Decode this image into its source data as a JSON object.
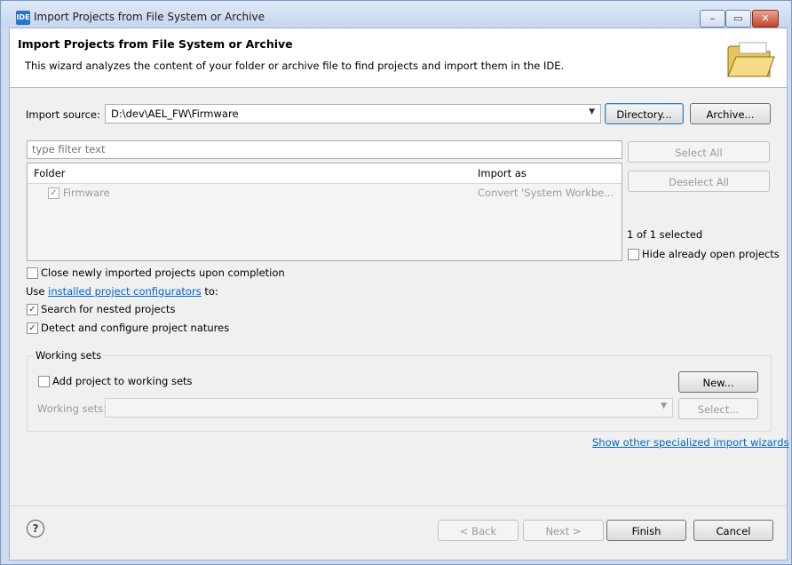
{
  "window": {
    "app_icon_text": "IDE",
    "title": "Import Projects from File System or Archive",
    "controls": {
      "minimize": "–",
      "maximize": "▭",
      "close": "✕"
    }
  },
  "header": {
    "title": "Import Projects from File System or Archive",
    "description": "This wizard analyzes the content of your folder or archive file to find projects and import them in the IDE.",
    "icon": "folder-open-icon"
  },
  "import_source": {
    "label": "Import source:",
    "value": "D:\\dev\\AEL_FW\\Firmware",
    "directory_button": "Directory...",
    "archive_button": "Archive..."
  },
  "filter": {
    "placeholder": "type filter text"
  },
  "tree": {
    "columns": [
      "Folder",
      "Import as"
    ],
    "rows": [
      {
        "checked": true,
        "folder": "Firmware",
        "import_as": "Convert 'System Workbe..."
      }
    ]
  },
  "side": {
    "select_all": "Select All",
    "deselect_all": "Deselect All",
    "selected_count": "1 of 1 selected",
    "hide_open_label": "Hide already open projects"
  },
  "options": {
    "close_label": "Close newly imported projects upon completion",
    "use_prefix": "Use ",
    "configurators_link": "installed project configurators",
    "use_suffix": " to:",
    "nested_label": "Search for nested projects",
    "natures_label": "Detect and configure project natures"
  },
  "working_sets": {
    "title": "Working sets",
    "add_label": "Add project to working sets",
    "new_button": "New...",
    "sets_label": "Working sets:",
    "select_button": "Select..."
  },
  "specialized_link": "Show other specialized import wizards",
  "footer": {
    "back": "< Back",
    "next": "Next >",
    "finish": "Finish",
    "cancel": "Cancel"
  }
}
